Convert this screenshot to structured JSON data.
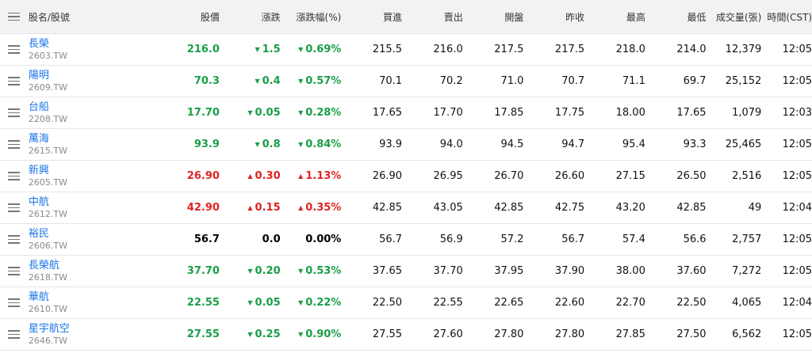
{
  "header": {
    "name": "股名/股號",
    "price": "股價",
    "change": "漲跌",
    "change_pct": "漲跌幅(%)",
    "bid": "買進",
    "ask": "賣出",
    "open": "開盤",
    "prev_close": "昨收",
    "high": "最高",
    "low": "最低",
    "volume": "成交量(張)",
    "time": "時間(CST)"
  },
  "colors": {
    "up": "#e02424",
    "down": "#1a9e47",
    "flat": "#000000",
    "link": "#1a73e8"
  },
  "icons": {
    "drag_handle": "drag-handle-icon",
    "up_arrow": "▲",
    "down_arrow": "▼"
  },
  "rows": [
    {
      "name": "長榮",
      "code": "2603.TW",
      "price": "216.0",
      "change": "1.5",
      "change_pct": "0.69%",
      "direction": "down",
      "bid": "215.5",
      "ask": "216.0",
      "open": "217.5",
      "prev_close": "217.5",
      "high": "218.0",
      "low": "214.0",
      "volume": "12,379",
      "time": "12:05"
    },
    {
      "name": "陽明",
      "code": "2609.TW",
      "price": "70.3",
      "change": "0.4",
      "change_pct": "0.57%",
      "direction": "down",
      "bid": "70.1",
      "ask": "70.2",
      "open": "71.0",
      "prev_close": "70.7",
      "high": "71.1",
      "low": "69.7",
      "volume": "25,152",
      "time": "12:05"
    },
    {
      "name": "台船",
      "code": "2208.TW",
      "price": "17.70",
      "change": "0.05",
      "change_pct": "0.28%",
      "direction": "down",
      "bid": "17.65",
      "ask": "17.70",
      "open": "17.85",
      "prev_close": "17.75",
      "high": "18.00",
      "low": "17.65",
      "volume": "1,079",
      "time": "12:03"
    },
    {
      "name": "萬海",
      "code": "2615.TW",
      "price": "93.9",
      "change": "0.8",
      "change_pct": "0.84%",
      "direction": "down",
      "bid": "93.9",
      "ask": "94.0",
      "open": "94.5",
      "prev_close": "94.7",
      "high": "95.4",
      "low": "93.3",
      "volume": "25,465",
      "time": "12:05"
    },
    {
      "name": "新興",
      "code": "2605.TW",
      "price": "26.90",
      "change": "0.30",
      "change_pct": "1.13%",
      "direction": "up",
      "bid": "26.90",
      "ask": "26.95",
      "open": "26.70",
      "prev_close": "26.60",
      "high": "27.15",
      "low": "26.50",
      "volume": "2,516",
      "time": "12:05"
    },
    {
      "name": "中航",
      "code": "2612.TW",
      "price": "42.90",
      "change": "0.15",
      "change_pct": "0.35%",
      "direction": "up",
      "bid": "42.85",
      "ask": "43.05",
      "open": "42.85",
      "prev_close": "42.75",
      "high": "43.20",
      "low": "42.85",
      "volume": "49",
      "time": "12:04"
    },
    {
      "name": "裕民",
      "code": "2606.TW",
      "price": "56.7",
      "change": "0.0",
      "change_pct": "0.00%",
      "direction": "flat",
      "bid": "56.7",
      "ask": "56.9",
      "open": "57.2",
      "prev_close": "56.7",
      "high": "57.4",
      "low": "56.6",
      "volume": "2,757",
      "time": "12:05"
    },
    {
      "name": "長榮航",
      "code": "2618.TW",
      "price": "37.70",
      "change": "0.20",
      "change_pct": "0.53%",
      "direction": "down",
      "bid": "37.65",
      "ask": "37.70",
      "open": "37.95",
      "prev_close": "37.90",
      "high": "38.00",
      "low": "37.60",
      "volume": "7,272",
      "time": "12:05"
    },
    {
      "name": "華航",
      "code": "2610.TW",
      "price": "22.55",
      "change": "0.05",
      "change_pct": "0.22%",
      "direction": "down",
      "bid": "22.50",
      "ask": "22.55",
      "open": "22.65",
      "prev_close": "22.60",
      "high": "22.70",
      "low": "22.50",
      "volume": "4,065",
      "time": "12:04"
    },
    {
      "name": "星宇航空",
      "code": "2646.TW",
      "price": "27.55",
      "change": "0.25",
      "change_pct": "0.90%",
      "direction": "down",
      "bid": "27.55",
      "ask": "27.60",
      "open": "27.80",
      "prev_close": "27.80",
      "high": "27.85",
      "low": "27.50",
      "volume": "6,562",
      "time": "12:05"
    }
  ]
}
